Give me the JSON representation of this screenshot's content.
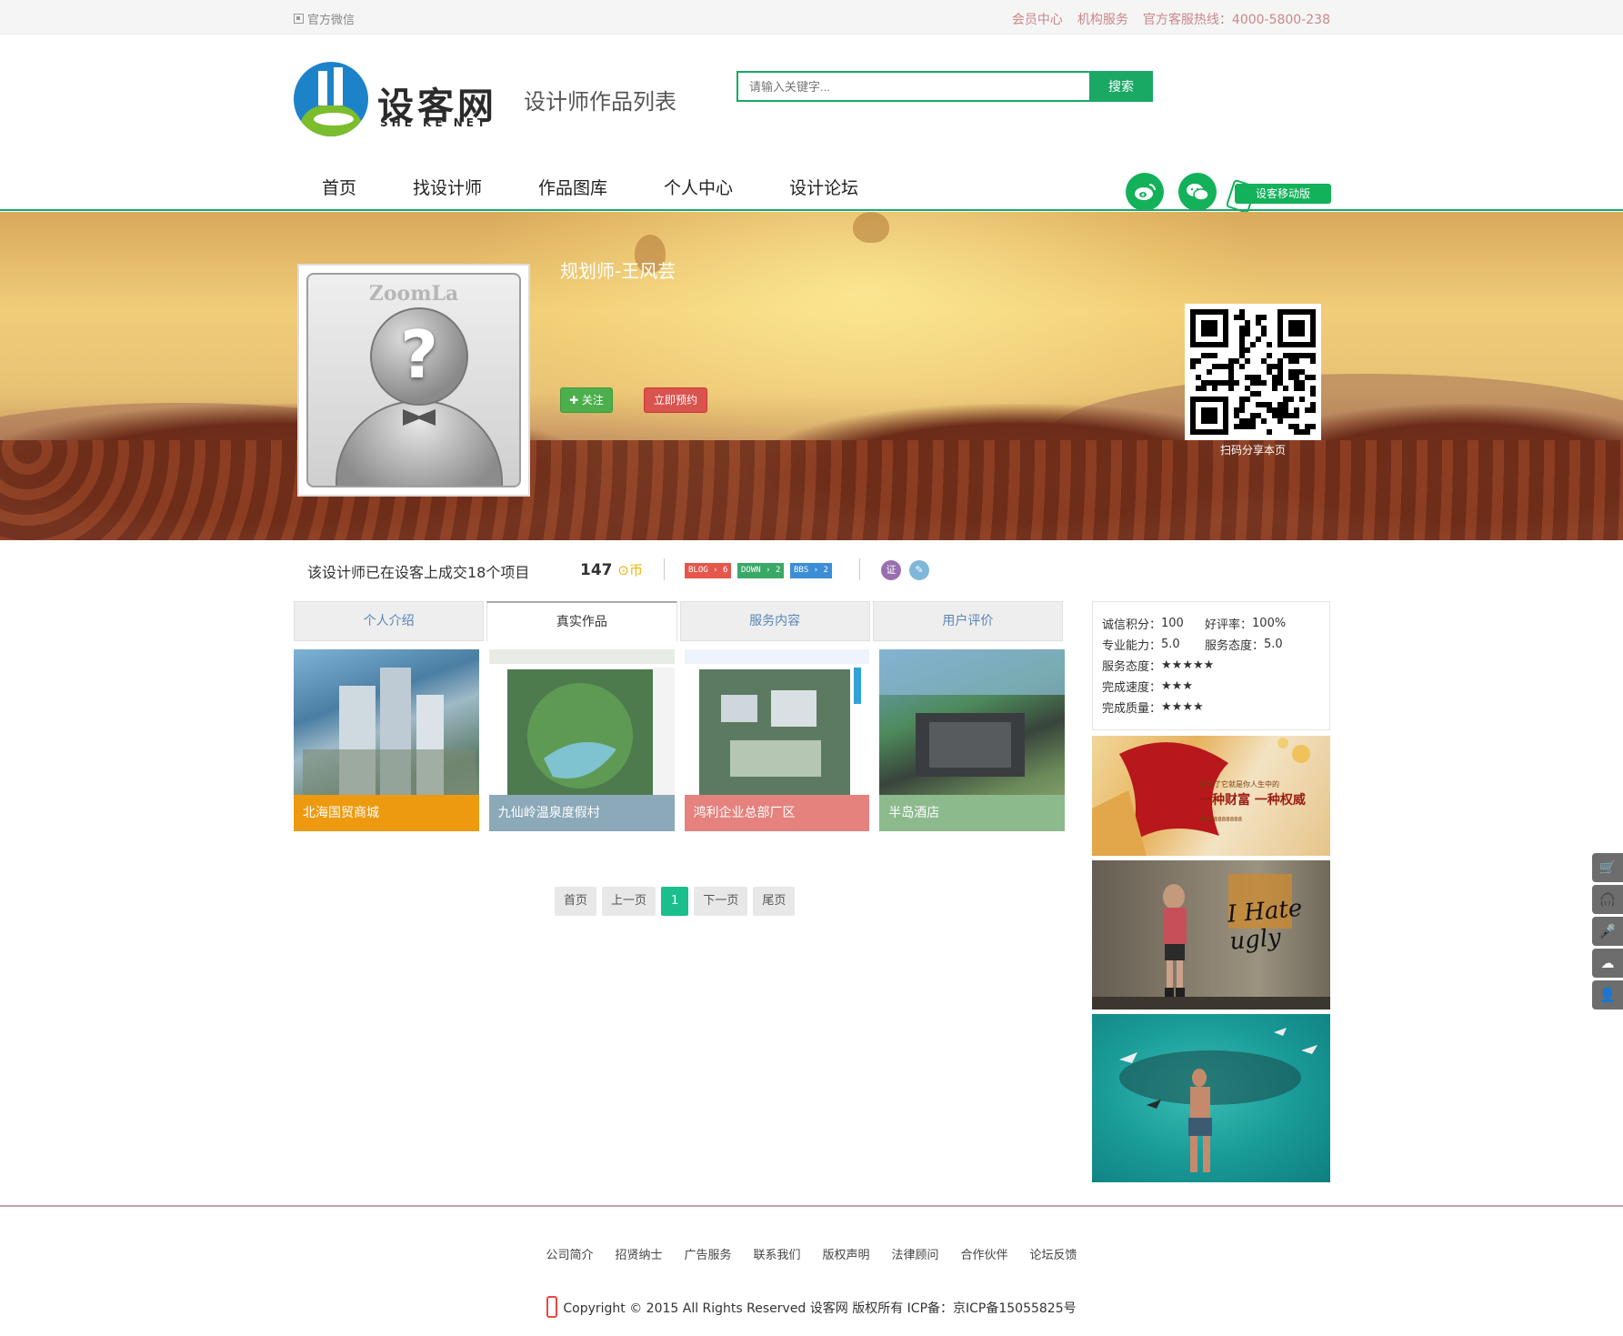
{
  "topbar": {
    "wechat_label": "官方微信",
    "member_center": "会员中心",
    "org_service": "机构服务",
    "hotline": "官方客服热线：4000-5800-238"
  },
  "header": {
    "logo_text": "设客网",
    "logo_sub": "SHE KE NET",
    "page_title": "设计师作品列表",
    "search_placeholder": "请输入关键字...",
    "search_button": "搜索"
  },
  "nav": {
    "items": [
      "首页",
      "找设计师",
      "作品图库",
      "个人中心",
      "设计论坛"
    ],
    "mobile_label": "设客移动版"
  },
  "profile": {
    "avatar_watermark": "ZoomLa",
    "name": "规划师-王风芸",
    "follow_label": "✚ 关注",
    "book_label": "立即预约",
    "qr_caption": "扫码分享本页"
  },
  "stats": {
    "projects_text": "该设计师已在设客上成交18个项目",
    "coins": "147",
    "coin_unit": "币",
    "tags": [
      {
        "label": "BLOG",
        "count": "6",
        "color": "#e4574d"
      },
      {
        "label": "DOWN",
        "count": "2",
        "color": "#3aa968"
      },
      {
        "label": "BBS",
        "count": "2",
        "color": "#3b8ed6"
      }
    ]
  },
  "tabs": [
    "个人介绍",
    "真实作品",
    "服务内容",
    "用户评价"
  ],
  "works": [
    {
      "title": "北海国贸商城",
      "label_color": "#ee9a10"
    },
    {
      "title": "九仙岭温泉度假村",
      "label_color": "#8ba9b9"
    },
    {
      "title": "鸿利企业总部厂区",
      "label_color": "#e5827e"
    },
    {
      "title": "半岛酒店",
      "label_color": "#8cba8d"
    }
  ],
  "pager": {
    "first": "首页",
    "prev": "上一页",
    "current": "1",
    "next": "下一页",
    "last": "尾页"
  },
  "sidebar": {
    "credit_label": "诚信积分：",
    "credit_value": "100",
    "good_rate_label": "好评率：",
    "good_rate_value": "100%",
    "skill_label": "专业能力：",
    "skill_value": "5.0",
    "attitude_label": "服务态度：",
    "attitude_value": "5.0",
    "attitude_stars_label": "服务态度：",
    "attitude_stars": "★★★★★",
    "speed_label": "完成速度：",
    "speed_stars": "★★★",
    "quality_label": "完成质量：",
    "quality_stars": "★★★★",
    "ad1_line1": "选中了它就是你人生中的",
    "ad1_line2": "一种财富 一种权威",
    "ad1_phone": "000-8888888",
    "ad2_text": "I Hate ugly"
  },
  "float_icons": [
    "cart-icon",
    "headset-icon",
    "microphone-icon",
    "qq-icon",
    "user-icon"
  ],
  "footer": {
    "links": [
      "公司简介",
      "招贤纳士",
      "广告服务",
      "联系我们",
      "版权声明",
      "法律顾问",
      "合作伙伴",
      "论坛反馈"
    ],
    "copyright": "Copyright © 2015 All Rights Reserved 设客网 版权所有 ICP备：京ICP备15055825号"
  }
}
